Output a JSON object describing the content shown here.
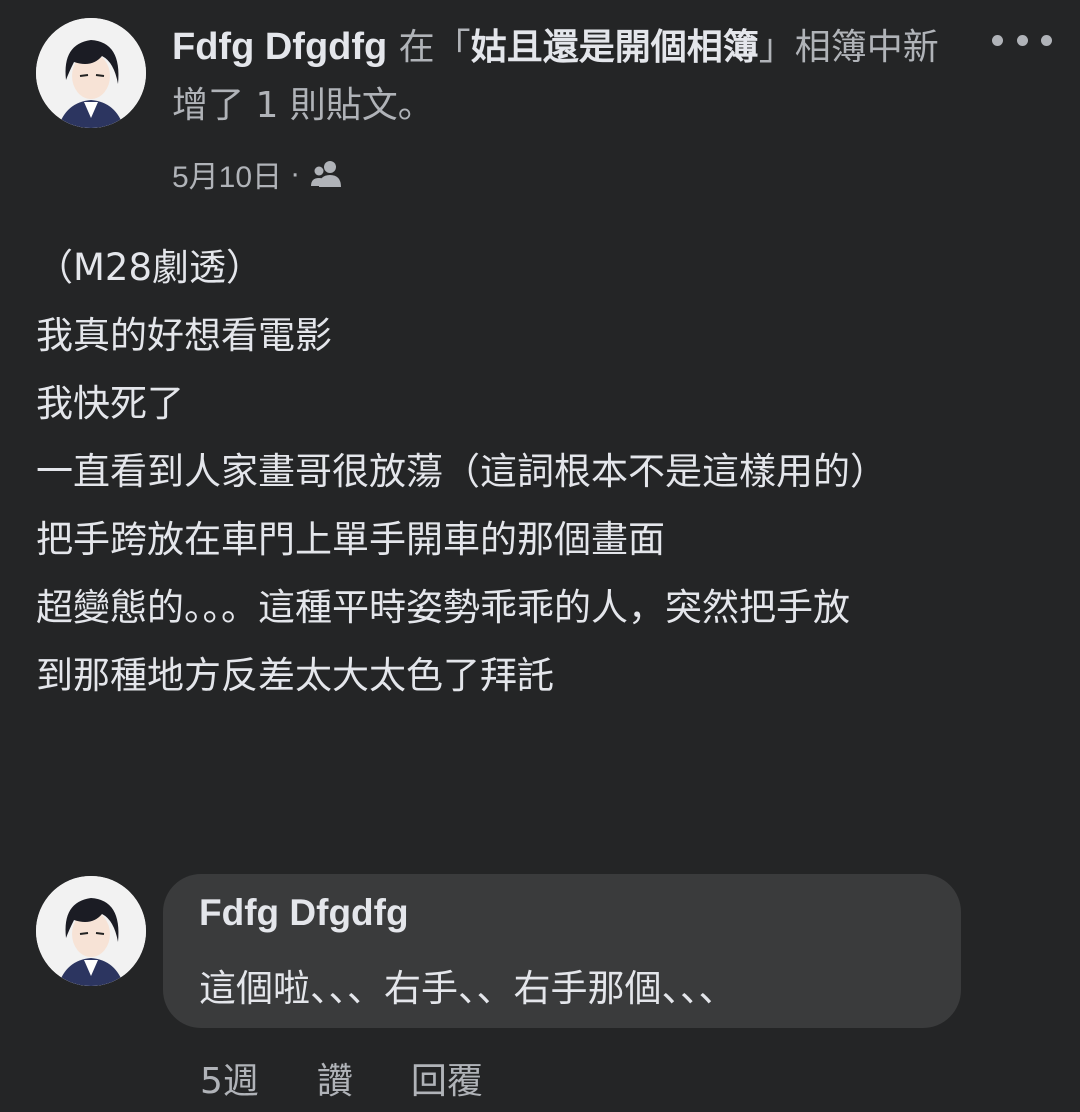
{
  "post": {
    "author": "Fdfg Dfgdfg",
    "header_prefix": " 在「",
    "album_name": "姑且還是開個相簿",
    "header_suffix": "」相簿中新增了 1 則貼文。",
    "date": "5月10日",
    "separator": "·",
    "privacy_icon": "friends-icon",
    "more_icon": "more-horizontal-icon",
    "body_lines": [
      "（M28劇透）",
      "我真的好想看電影",
      "我快死了",
      "一直看到人家畫哥很放蕩（這詞根本不是這樣用的）",
      "把手跨放在車門上單手開車的那個畫面",
      "超變態的。。。這種平時姿勢乖乖的人，突然把手放",
      "到那種地方反差太大太色了拜託"
    ]
  },
  "comment": {
    "author": "Fdfg Dfgdfg",
    "text": "這個啦、、、右手、、右手那個、、、",
    "time": "5週",
    "like_label": "讚",
    "reply_label": "回覆"
  },
  "colors": {
    "background": "#242526",
    "bubble": "#3a3b3c",
    "primary_text": "#e4e6eb",
    "secondary_text": "#b0b3b8"
  }
}
